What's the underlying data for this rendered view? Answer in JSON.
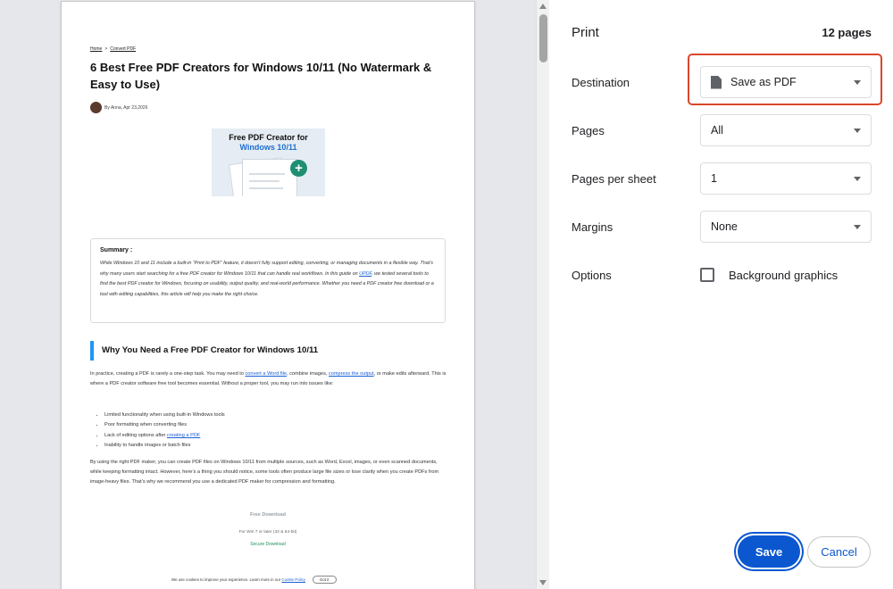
{
  "preview": {
    "breadcrumb": {
      "home": "Home",
      "separator": ">",
      "section": "Convert PDF"
    },
    "article_title": "6 Best Free PDF Creators for Windows 10/11 (No Watermark & Easy to Use)",
    "byline": "By Anna, Apr 23,2026",
    "hero": {
      "line1": "Free PDF Creator for",
      "line2": "Windows 10/11",
      "plus": "+"
    },
    "summary": {
      "heading": "Summary :",
      "text_before_link": "While Windows 10 and 11 include a built-in “Print to PDF” feature, it doesn’t fully support editing, converting, or managing documents in a flexible way. That’s why many users start searching for a free PDF creator for Windows 10/11 that can handle real workflows. In this guide on ",
      "link": "UPDF",
      "text_after_link": ", we tested several tools to find the best PDF creator for Windows, focusing on usability, output quality, and real-world performance. Whether you need a PDF creator free download or a tool with editing capabilities, this article will help you make the right choice."
    },
    "section_heading": "Why You Need a Free PDF Creator for Windows 10/11",
    "para1": {
      "t1": "In practice, creating a PDF is rarely a one-step task. You may need to ",
      "l1": "convert a Word file",
      "t2": ", combine images, ",
      "l2": "compress the output",
      "t3": ", or make edits afterward. This is where a PDF creator software free tool becomes essential. Without a proper tool, you may run into issues like:"
    },
    "bullets": [
      {
        "text": "Limited functionality when using built-in Windows tools",
        "link": ""
      },
      {
        "text": "Poor formatting when converting files",
        "link": ""
      },
      {
        "text": "Lack of editing options after ",
        "link": "creating a PDF"
      },
      {
        "text": "Inability to handle images or batch files",
        "link": ""
      }
    ],
    "para2": "By using the right PDF maker, you can create PDF files on Windows 10/11 from multiple sources, such as Word, Excel, images, or even scanned documents, while keeping formatting intact. However, here’s a thing you should notice, some tools often produce large file sizes or lose clarity when you create PDFs from image-heavy files. That’s why we recommend you use a dedicated PDF maker for compression and formatting.",
    "free_download": "Free Download",
    "requirements": "For Win 7 or later (32 & 64-bit)",
    "secure_download": "Secure Download",
    "cookie": {
      "text": "We use cookies to improve your experience. Learn more in our ",
      "link": "Cookie Policy",
      "button": "Got it"
    }
  },
  "settings": {
    "title": "Print",
    "page_count": "12 pages",
    "destination": {
      "label": "Destination",
      "value": "Save as PDF",
      "icon": "document-icon"
    },
    "pages": {
      "label": "Pages",
      "value": "All"
    },
    "pages_per_sheet": {
      "label": "Pages per sheet",
      "value": "1"
    },
    "margins": {
      "label": "Margins",
      "value": "None"
    },
    "options": {
      "label": "Options",
      "checkbox_label": "Background graphics",
      "checked": false
    },
    "save_label": "Save",
    "cancel_label": "Cancel"
  },
  "colors": {
    "accent": "#0b57d0",
    "highlight_box": "#d9472b",
    "preview_background": "#e6e7ea",
    "link": "#1a5fd6",
    "heading_bar": "#2196f3",
    "secure_download": "#1f8e5a"
  }
}
